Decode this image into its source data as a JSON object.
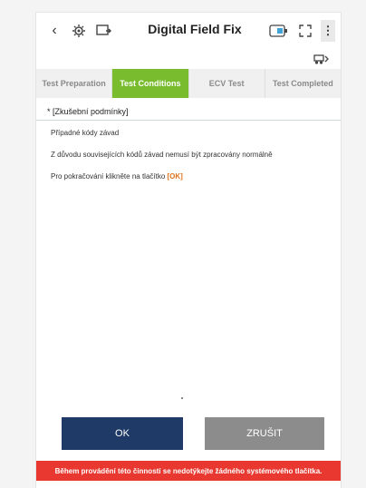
{
  "header": {
    "back_icon": "chevron-left-icon",
    "title": "Digital Field Fix"
  },
  "steps": [
    {
      "label": "Test Preparation",
      "active": false
    },
    {
      "label": "Test Conditions",
      "active": true
    },
    {
      "label": "ECV Test",
      "active": false
    },
    {
      "label": "Test Completed",
      "active": false
    }
  ],
  "content": {
    "section_title": "* [Zkušební podmínky]",
    "line1": "Případné kódy závad",
    "line2": "Z důvodu souvisejících kódů závad nemusí být zpracovány normálně",
    "line3_prefix": "Pro pokračování klikněte na tlačítko ",
    "line3_ok": "[OK]"
  },
  "buttons": {
    "ok": "OK",
    "cancel": "ZRUŠIT"
  },
  "warning": "Během provádění této činností se nedotýkejte žádného systémového tlačítka.",
  "colors": {
    "active_step": "#79bd2f",
    "ok_button": "#1f3a66",
    "cancel_button": "#8c8c8c",
    "warning_bar": "#e8382f",
    "ok_highlight": "#e0731e"
  }
}
